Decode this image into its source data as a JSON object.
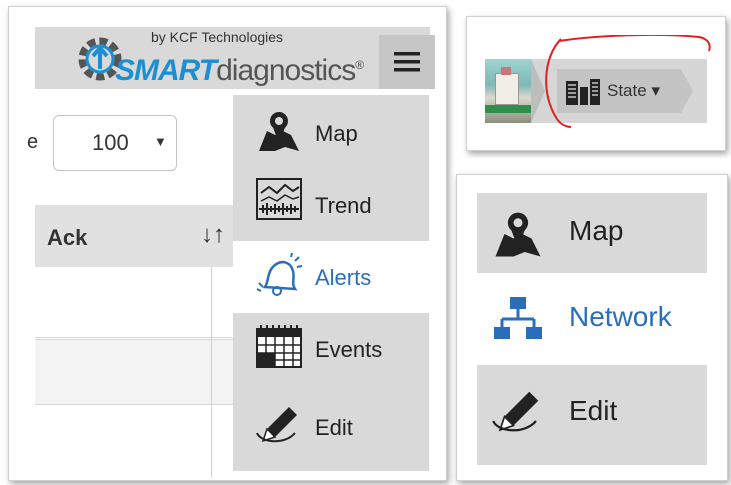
{
  "brand": {
    "by_line": "by KCF Technologies",
    "name_smart": "SMART",
    "name_rest": "diagnostics",
    "registered": "®",
    "menu_icon": "hamburger-icon"
  },
  "table": {
    "page_size_prefix": "e",
    "page_size_value": "100",
    "column_header": "Ack",
    "sort_icon": "sort-icon"
  },
  "side_menu": {
    "items": [
      {
        "label": "Map",
        "icon": "map-icon",
        "active": false
      },
      {
        "label": "Trend",
        "icon": "trend-icon",
        "active": false
      },
      {
        "label": "Alerts",
        "icon": "bell-icon",
        "active": true
      },
      {
        "label": "Events",
        "icon": "calendar-icon",
        "active": false
      },
      {
        "label": "Edit",
        "icon": "pencil-icon",
        "active": false
      }
    ]
  },
  "breadcrumb": {
    "state_label": "State",
    "state_icon": "buildings-icon",
    "dropdown_glyph": "▾"
  },
  "menu_alt": {
    "items": [
      {
        "label": "Map",
        "icon": "map-icon",
        "active": false
      },
      {
        "label": "Network",
        "icon": "network-icon",
        "active": true
      },
      {
        "label": "Edit",
        "icon": "pencil-icon",
        "active": false
      }
    ]
  },
  "colors": {
    "brand_blue": "#1c8fd3",
    "active_blue": "#2a6ebb",
    "menu_grey": "#d9d9d9",
    "annotation_red": "#e02020"
  }
}
